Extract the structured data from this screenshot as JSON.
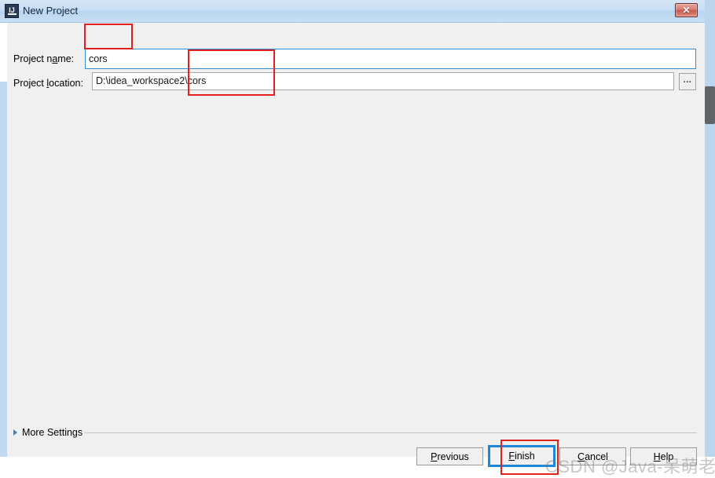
{
  "window": {
    "title": "New Project",
    "app_icon": "intellij-idea-icon",
    "close_label": "✕"
  },
  "form": {
    "project_name": {
      "label_before": "Project n",
      "label_mnemonic": "a",
      "label_after": "me:",
      "label_full": "Project name:",
      "value": "cors",
      "focused": true
    },
    "project_location": {
      "label_before": "Project ",
      "label_mnemonic": "l",
      "label_after": "ocation:",
      "label_full": "Project location:",
      "value": "D:\\idea_workspace2\\cors",
      "browse_label": "..."
    }
  },
  "more_settings": {
    "label_before": "Mor",
    "label_mnemonic": "e",
    "label_after": " Settings",
    "label_full": "More Settings",
    "expanded": false,
    "chevron": "triangle-right-icon"
  },
  "buttons": [
    {
      "name": "previous",
      "before": "",
      "mnemonic": "P",
      "after": "revious",
      "label": "Previous",
      "default": false
    },
    {
      "name": "finish",
      "before": "",
      "mnemonic": "F",
      "after": "inish",
      "label": "Finish",
      "default": true
    },
    {
      "name": "cancel",
      "before": "",
      "mnemonic": "C",
      "after": "ancel",
      "label": "Cancel",
      "default": false
    },
    {
      "name": "help",
      "before": "",
      "mnemonic": "H",
      "after": "elp",
      "label": "Help",
      "default": false
    }
  ],
  "annotations": [
    {
      "name": "project-name-highlight",
      "color": "#e32020"
    },
    {
      "name": "project-location-highlight",
      "color": "#e32020"
    },
    {
      "name": "finish-button-highlight",
      "color": "#e32020"
    }
  ],
  "watermark": {
    "text": "CSDN @Java-呆萌老师"
  },
  "colors": {
    "titlebar_gradient_top": "#d7e7f7",
    "titlebar_gradient_bottom": "#c9e0f5",
    "dialog_background": "#f0f0f0",
    "focus_border": "#2f8ed6",
    "default_button_border": "#1e87d8",
    "annotation_red": "#e32020",
    "left_edge_blue": "#c3d9ef",
    "scrollbar_thumb": "#5f6468"
  }
}
